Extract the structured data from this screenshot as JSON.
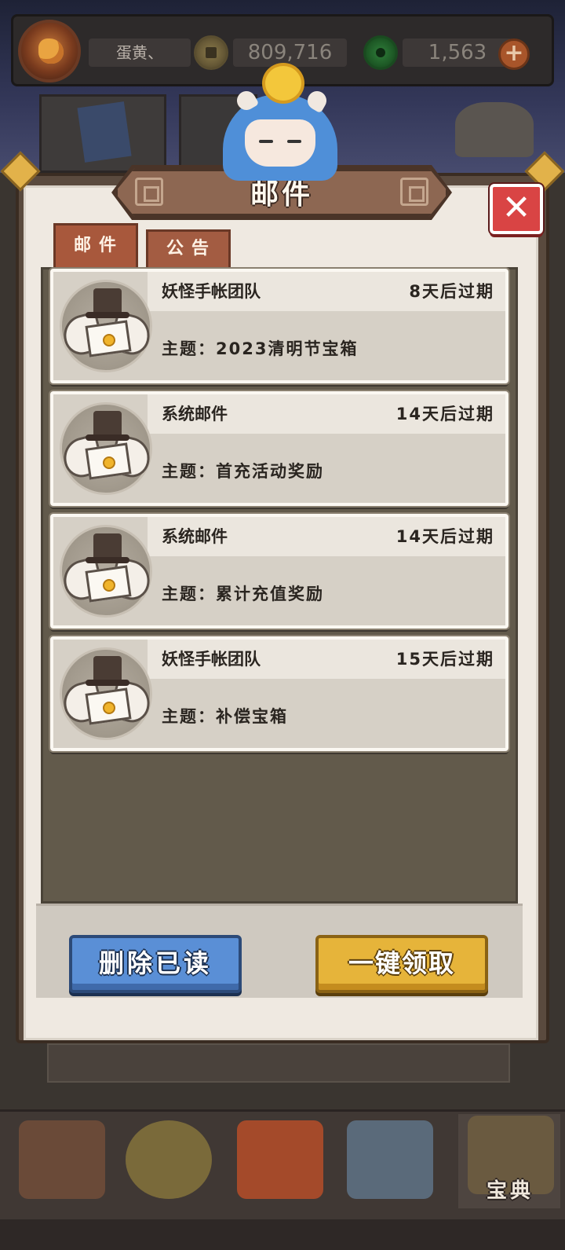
{
  "hud": {
    "player_name": "蛋黄、",
    "coins": "809,716",
    "jade": "1,563",
    "plus_label": "+"
  },
  "dialog": {
    "title": "邮件",
    "close_label": "✕",
    "tabs": [
      {
        "label": "邮件",
        "active": true
      },
      {
        "label": "公告",
        "active": false
      }
    ],
    "mails": [
      {
        "sender": "妖怪手帐团队",
        "expiry": "8天后过期",
        "subject": "主题：2023清明节宝箱"
      },
      {
        "sender": "系统邮件",
        "expiry": "14天后过期",
        "subject": "主题：首充活动奖励"
      },
      {
        "sender": "系统邮件",
        "expiry": "14天后过期",
        "subject": "主题：累计充值奖励"
      },
      {
        "sender": "妖怪手帐团队",
        "expiry": "15天后过期",
        "subject": "主题：补偿宝箱"
      }
    ],
    "delete_read_label": "删除已读",
    "claim_all_label": "一键领取"
  },
  "nav": {
    "active_label": "宝典"
  },
  "colors": {
    "accent_red": "#d94444",
    "tab_brown": "#a8583c",
    "button_blue": "#5a8fd6",
    "button_gold": "#e6b43a"
  }
}
